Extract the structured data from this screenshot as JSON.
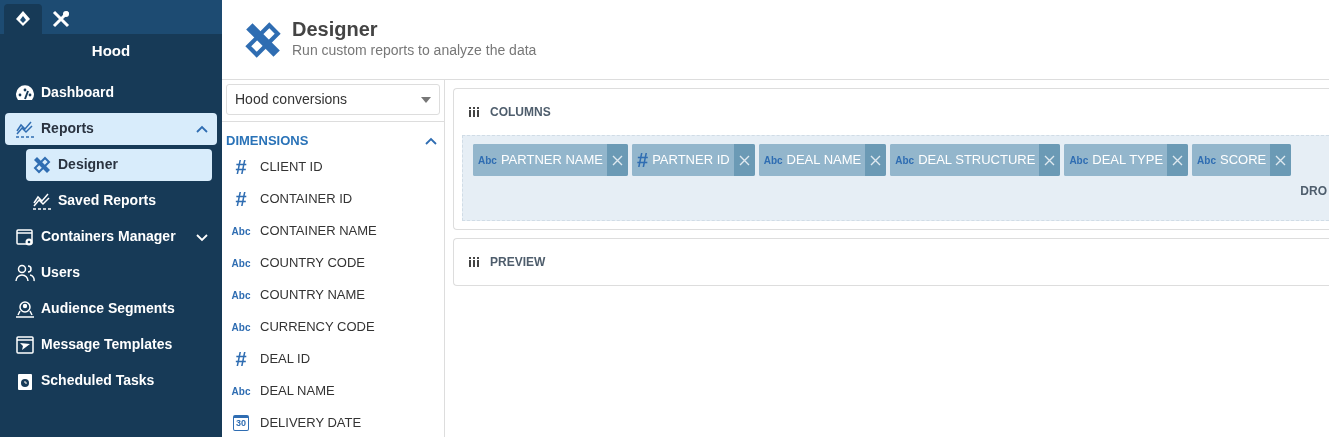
{
  "sidebar": {
    "tabs": [
      {
        "selected": true
      },
      {
        "selected": false
      }
    ],
    "title": "Hood",
    "items": [
      {
        "label": "Dashboard",
        "selected": false
      },
      {
        "label": "Reports",
        "selected": true,
        "expanded": true,
        "children": [
          {
            "label": "Designer",
            "selected": true
          },
          {
            "label": "Saved Reports",
            "selected": false
          }
        ]
      },
      {
        "label": "Containers Manager",
        "selected": false,
        "expanded": false
      },
      {
        "label": "Users",
        "selected": false
      },
      {
        "label": "Audience Segments",
        "selected": false
      },
      {
        "label": "Message Templates",
        "selected": false
      },
      {
        "label": "Scheduled Tasks",
        "selected": false
      }
    ]
  },
  "header": {
    "title": "Designer",
    "subtitle": "Run custom reports to analyze the data"
  },
  "source_select": {
    "value": "Hood conversions"
  },
  "dimensions": {
    "title": "DIMENSIONS",
    "expanded": true,
    "fields": [
      {
        "name": "CLIENT ID",
        "kind": "number",
        "type_label": "#"
      },
      {
        "name": "CONTAINER ID",
        "kind": "number",
        "type_label": "#"
      },
      {
        "name": "CONTAINER NAME",
        "kind": "text",
        "type_label": "Abc"
      },
      {
        "name": "COUNTRY CODE",
        "kind": "text",
        "type_label": "Abc"
      },
      {
        "name": "COUNTRY NAME",
        "kind": "text",
        "type_label": "Abc"
      },
      {
        "name": "CURRENCY CODE",
        "kind": "text",
        "type_label": "Abc"
      },
      {
        "name": "DEAL ID",
        "kind": "number",
        "type_label": "#"
      },
      {
        "name": "DEAL NAME",
        "kind": "text",
        "type_label": "Abc"
      },
      {
        "name": "DELIVERY DATE",
        "kind": "date",
        "type_label": "30"
      }
    ]
  },
  "columns_panel": {
    "title": "COLUMNS",
    "chips": [
      {
        "name": "PARTNER NAME",
        "kind": "text",
        "type_label": "Abc"
      },
      {
        "name": "PARTNER ID",
        "kind": "number",
        "type_label": "#"
      },
      {
        "name": "DEAL NAME",
        "kind": "text",
        "type_label": "Abc"
      },
      {
        "name": "DEAL STRUCTURE",
        "kind": "text",
        "type_label": "Abc"
      },
      {
        "name": "DEAL TYPE",
        "kind": "text",
        "type_label": "Abc"
      },
      {
        "name": "SCORE",
        "kind": "text",
        "type_label": "Abc"
      }
    ],
    "drop_hint": "DRO"
  },
  "preview_panel": {
    "title": "PREVIEW"
  }
}
